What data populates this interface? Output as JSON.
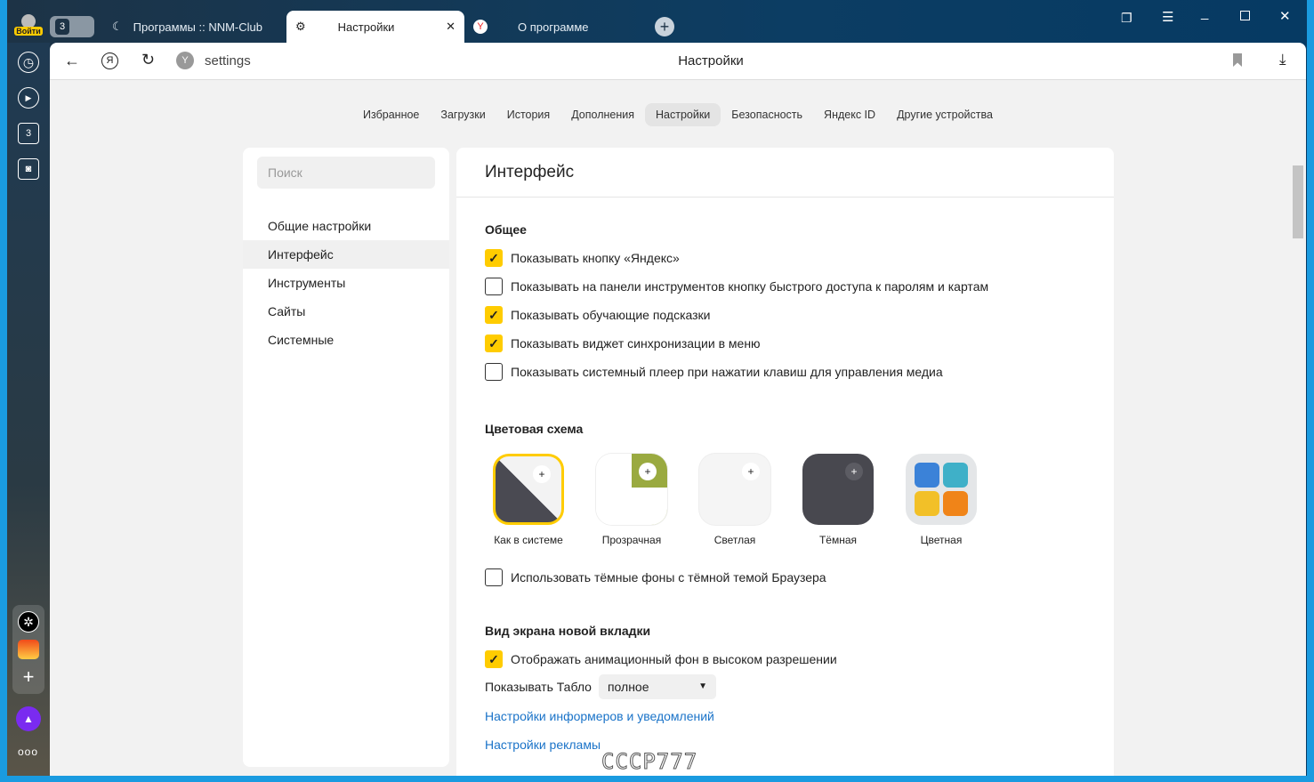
{
  "sidebar": {
    "login": "Войти",
    "tab_count": "3",
    "items": [
      "history-icon",
      "video-icon",
      "tabs-counter-icon",
      "screenshot-icon"
    ],
    "bottom": [
      "settings-wheel-icon",
      "mail-icon",
      "add-icon",
      "alice-icon",
      "more-icon"
    ]
  },
  "tabs": [
    {
      "label": "Программы :: NNM-Club"
    },
    {
      "label": "Настройки",
      "active": true
    },
    {
      "label": "О программе"
    }
  ],
  "address": {
    "value": "settings",
    "title": "Настройки"
  },
  "nav": [
    "Избранное",
    "Загрузки",
    "История",
    "Дополнения",
    "Настройки",
    "Безопасность",
    "Яндекс ID",
    "Другие устройства"
  ],
  "nav_selected": "Настройки",
  "left": {
    "search_placeholder": "Поиск",
    "items": [
      "Общие настройки",
      "Интерфейс",
      "Инструменты",
      "Сайты",
      "Системные"
    ],
    "selected": "Интерфейс"
  },
  "main": {
    "title": "Интерфейс",
    "general": {
      "title": "Общее",
      "options": [
        {
          "label": "Показывать кнопку «Яндекс»",
          "checked": true
        },
        {
          "label": "Показывать на панели инструментов кнопку быстрого доступа к паролям и картам",
          "checked": false
        },
        {
          "label": "Показывать обучающие подсказки",
          "checked": true
        },
        {
          "label": "Показывать виджет синхронизации в меню",
          "checked": true
        },
        {
          "label": "Показывать системный плеер при нажатии клавиш для управления медиа",
          "checked": false
        }
      ]
    },
    "color": {
      "title": "Цветовая схема",
      "themes": [
        "Как в системе",
        "Прозрачная",
        "Светлая",
        "Тёмная",
        "Цветная"
      ],
      "selected": "Как в системе",
      "dark_bg": {
        "label": "Использовать тёмные фоны с тёмной темой Браузера",
        "checked": false
      }
    },
    "newtab": {
      "title": "Вид экрана новой вкладки",
      "anim": {
        "label": "Отображать анимационный фон в высоком разрешении",
        "checked": true
      },
      "tablo_label": "Показывать Табло",
      "tablo_value": "полное",
      "link1": "Настройки информеров и уведомлений",
      "link2": "Настройки рекламы"
    }
  },
  "watermark": "СССР777",
  "colors": {
    "accent": "#ffcc00",
    "link": "#1a73c8",
    "titlebar": "#0c3d63"
  }
}
